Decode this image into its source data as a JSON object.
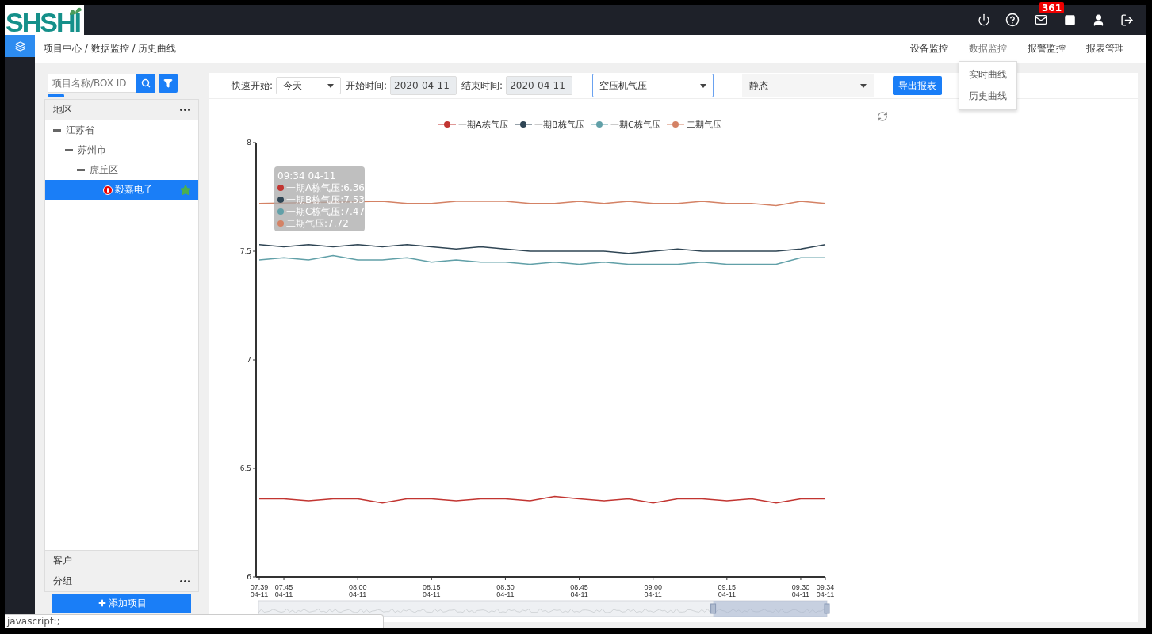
{
  "logo": {
    "text": "SHSHI"
  },
  "header": {
    "mail_badge": "361"
  },
  "breadcrumb": "项目中心 / 数据监控 / 历史曲线",
  "nav": [
    {
      "label": "设备监控",
      "selected": false
    },
    {
      "label": "数据监控",
      "selected": true
    },
    {
      "label": "报警监控",
      "selected": false
    },
    {
      "label": "报表管理",
      "selected": false
    }
  ],
  "nav_menu": [
    "实时曲线",
    "历史曲线"
  ],
  "sidebar": {
    "search": {
      "placeholder": "项目名称/BOX ID"
    },
    "region_header": "地区",
    "tree": [
      {
        "label": "江苏省",
        "expanded": true,
        "selected": false,
        "children": [
          {
            "label": "苏州市",
            "expanded": true,
            "selected": false,
            "children": [
              {
                "label": "虎丘区",
                "expanded": true,
                "selected": false,
                "children": [
                  {
                    "label": "毅嘉电子",
                    "selected": true,
                    "alarm": true,
                    "favorite": true
                  }
                ]
              }
            ]
          }
        ]
      }
    ],
    "footer_sections": [
      {
        "label": "客户",
        "more": false
      },
      {
        "label": "分组",
        "more": true
      }
    ],
    "add_button": "添加项目"
  },
  "toolbar": {
    "quick_start_label": "快速开始:",
    "quick_start": "今天",
    "start_label": "开始时间:",
    "start_date": {
      "value": "2020-04-11",
      "disabled": true
    },
    "end_label": "结束时间:",
    "end_date": {
      "value": "2020-04-11",
      "disabled": true
    },
    "metric_select": {
      "value": "空压机气压",
      "focused": true
    },
    "mode_select": {
      "value": "静态",
      "focused": false
    },
    "export_button": "导出报表"
  },
  "chart": {
    "chart_data": {
      "type": "line",
      "categories": [
        "07:39 04-11",
        "07:45 04-11",
        null,
        null,
        "08:00 04-11",
        null,
        null,
        "08:15 04-11",
        null,
        null,
        "08:30 04-11",
        null,
        null,
        "08:45 04-11",
        null,
        null,
        "09:00 04-11",
        null,
        null,
        "09:15 04-11",
        null,
        null,
        "09:30 04-11",
        "09:34 04-11"
      ],
      "ylim": [
        6,
        8
      ],
      "yticks": [
        6,
        6.5,
        7,
        7.5,
        8
      ],
      "legend": true,
      "series": [
        {
          "name": "一期A栋气压",
          "color": "#c23531",
          "values": [
            6.36,
            6.36,
            6.35,
            6.36,
            6.36,
            6.34,
            6.36,
            6.36,
            6.35,
            6.36,
            6.36,
            6.35,
            6.37,
            6.36,
            6.35,
            6.36,
            6.34,
            6.36,
            6.36,
            6.35,
            6.36,
            6.34,
            6.36,
            6.36
          ]
        },
        {
          "name": "一期B栋气压",
          "color": "#2f4554",
          "values": [
            7.53,
            7.52,
            7.53,
            7.52,
            7.53,
            7.52,
            7.53,
            7.52,
            7.51,
            7.52,
            7.51,
            7.5,
            7.5,
            7.5,
            7.5,
            7.49,
            7.5,
            7.51,
            7.5,
            7.5,
            7.5,
            7.5,
            7.51,
            7.53
          ]
        },
        {
          "name": "一期C栋气压",
          "color": "#61a0a8",
          "values": [
            7.46,
            7.47,
            7.46,
            7.48,
            7.46,
            7.46,
            7.47,
            7.45,
            7.46,
            7.45,
            7.45,
            7.44,
            7.45,
            7.44,
            7.45,
            7.44,
            7.44,
            7.44,
            7.45,
            7.44,
            7.44,
            7.44,
            7.47,
            7.47
          ]
        },
        {
          "name": "二期气压",
          "color": "#d48265",
          "values": [
            7.72,
            null,
            null,
            null,
            null,
            7.73,
            7.72,
            7.72,
            7.73,
            7.73,
            7.73,
            7.72,
            7.72,
            7.73,
            7.72,
            7.73,
            7.72,
            7.72,
            7.73,
            7.72,
            7.72,
            7.71,
            7.73,
            7.72
          ]
        }
      ]
    },
    "tooltip": {
      "title": "09:34 04-11",
      "lines": [
        "一期A栋气压:6.36",
        "一期B栋气压:7.53",
        "一期C栋气压:7.47",
        "二期气压:7.72"
      ]
    },
    "range_selector": {
      "level": 0.2
    }
  },
  "status_bar": "javascript:;"
}
